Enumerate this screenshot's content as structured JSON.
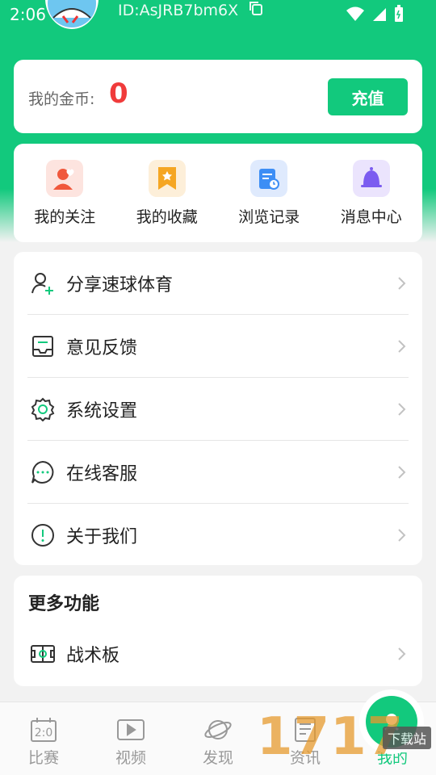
{
  "status_bar": {
    "time": "2:06"
  },
  "profile": {
    "user_id": "ID:AsJRB7bm6X"
  },
  "coins": {
    "label": "我的金币:",
    "value": "0",
    "recharge_label": "充值"
  },
  "quick_actions": [
    {
      "label": "我的关注",
      "icon": "follow-icon",
      "color": "#f0583c"
    },
    {
      "label": "我的收藏",
      "icon": "favorite-icon",
      "color": "#f5a623"
    },
    {
      "label": "浏览记录",
      "icon": "history-icon",
      "color": "#3d8ef5"
    },
    {
      "label": "消息中心",
      "icon": "bell-icon",
      "color": "#7b5cf0"
    }
  ],
  "menu": {
    "items": [
      {
        "label": "分享速球体育",
        "icon": "share-user-icon"
      },
      {
        "label": "意见反馈",
        "icon": "feedback-icon"
      },
      {
        "label": "系统设置",
        "icon": "gear-icon"
      },
      {
        "label": "在线客服",
        "icon": "chat-icon"
      },
      {
        "label": "关于我们",
        "icon": "info-icon"
      }
    ]
  },
  "more": {
    "title": "更多功能",
    "items": [
      {
        "label": "战术板",
        "icon": "tactics-board-icon"
      }
    ]
  },
  "tabbar": {
    "tabs": [
      {
        "label": "比赛",
        "icon": "scoreboard-icon"
      },
      {
        "label": "视频",
        "icon": "video-icon"
      },
      {
        "label": "发现",
        "icon": "planet-icon"
      },
      {
        "label": "资讯",
        "icon": "news-icon"
      },
      {
        "label": "我的",
        "icon": "profile-icon"
      }
    ]
  },
  "watermark": {
    "text": "1717",
    "sub": "下载站"
  },
  "colors": {
    "brand": "#12c97d",
    "coin": "#f03b3b"
  }
}
